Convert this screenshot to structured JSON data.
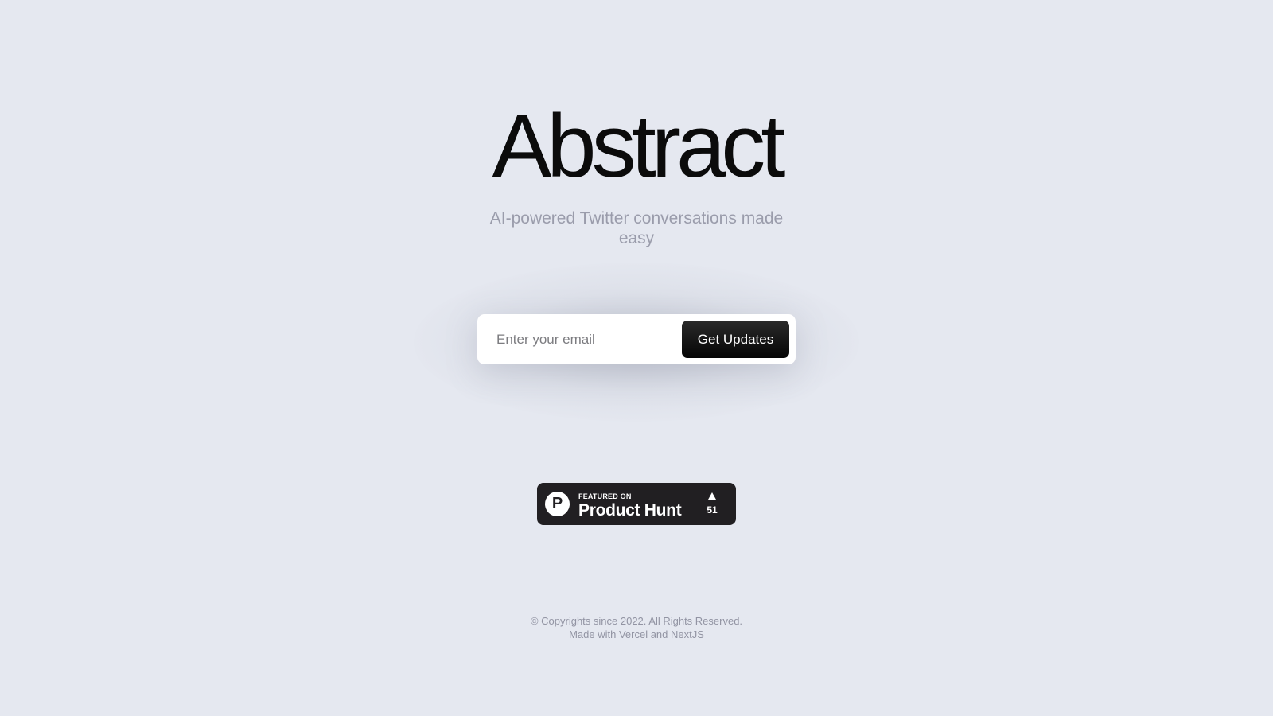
{
  "hero": {
    "title": "Abstract",
    "subtitle": "AI-powered Twitter conversations made easy"
  },
  "signup": {
    "email_placeholder": "Enter your email",
    "submit_label": "Get Updates"
  },
  "product_hunt_badge": {
    "featured_text": "FEATURED ON",
    "name": "Product Hunt",
    "logo_letter": "P",
    "upvote_count": "51"
  },
  "footer": {
    "copyright": "© Copyrights since 2022. All Rights Reserved.",
    "made_with": "Made with Vercel and NextJS"
  },
  "colors": {
    "background": "#e5e8f0",
    "title": "#0b0b0b",
    "subtitle": "#9a9cab",
    "button": "#0a0a0a",
    "badge": "#211f22"
  }
}
